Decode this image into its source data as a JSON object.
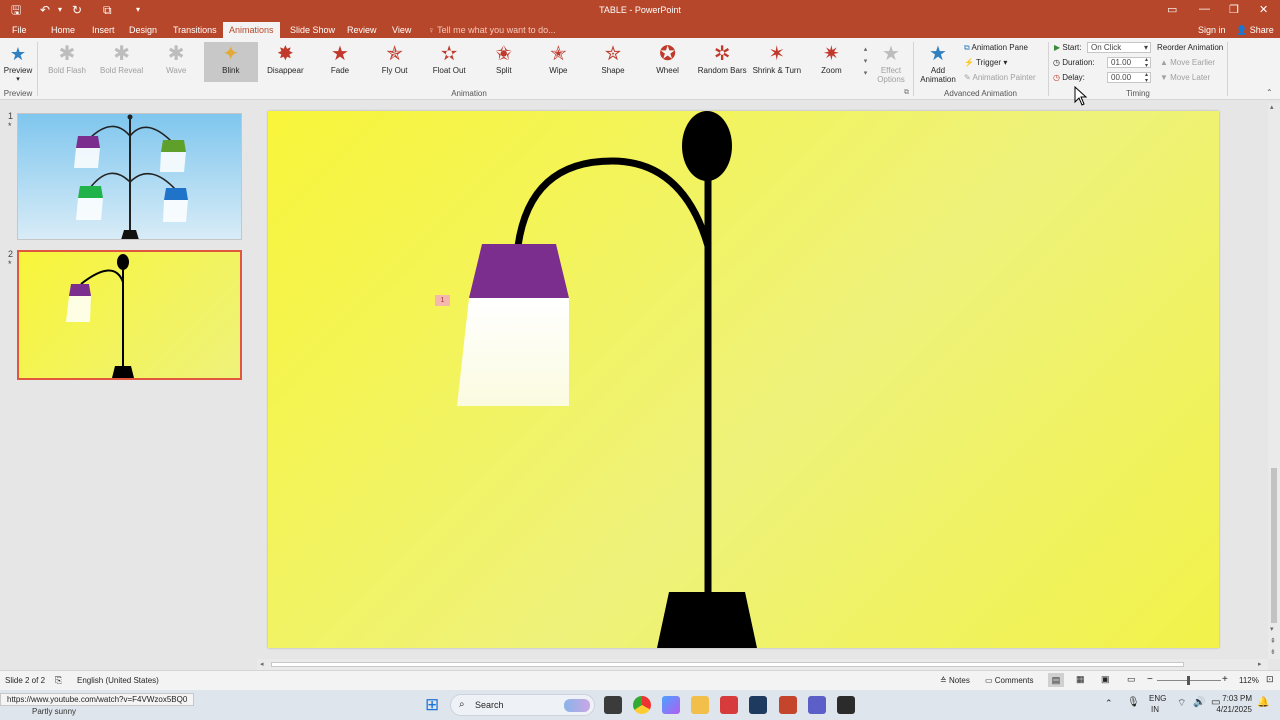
{
  "window": {
    "title": "TABLE - PowerPoint",
    "sign_in": "Sign in",
    "share": "Share"
  },
  "tabs": [
    "File",
    "Home",
    "Insert",
    "Design",
    "Transitions",
    "Animations",
    "Slide Show",
    "Review",
    "View"
  ],
  "active_tab": "Animations",
  "tell_me": "Tell me what you want to do...",
  "ribbon": {
    "preview": {
      "button": "Preview",
      "group": "Preview"
    },
    "animation_group": "Animation",
    "animations": [
      {
        "label": "Bold Flash",
        "state": "disabled"
      },
      {
        "label": "Bold Reveal",
        "state": "disabled"
      },
      {
        "label": "Wave",
        "state": "disabled"
      },
      {
        "label": "Blink",
        "state": "selected"
      },
      {
        "label": "Disappear",
        "state": "normal"
      },
      {
        "label": "Fade",
        "state": "normal"
      },
      {
        "label": "Fly Out",
        "state": "normal"
      },
      {
        "label": "Float Out",
        "state": "normal"
      },
      {
        "label": "Split",
        "state": "normal"
      },
      {
        "label": "Wipe",
        "state": "normal"
      },
      {
        "label": "Shape",
        "state": "normal"
      },
      {
        "label": "Wheel",
        "state": "normal"
      },
      {
        "label": "Random Bars",
        "state": "normal"
      },
      {
        "label": "Shrink & Turn",
        "state": "normal"
      },
      {
        "label": "Zoom",
        "state": "normal"
      }
    ],
    "effect_options": {
      "line1": "Effect",
      "line2": "Options"
    },
    "advanced": {
      "group": "Advanced Animation",
      "add_line1": "Add",
      "add_line2": "Animation",
      "pane": "Animation Pane",
      "trigger": "Trigger",
      "painter": "Animation Painter"
    },
    "timing": {
      "group": "Timing",
      "start_label": "Start:",
      "start_value": "On Click",
      "duration_label": "Duration:",
      "duration_value": "01.00",
      "delay_label": "Delay:",
      "delay_value": "00.00",
      "reorder": "Reorder Animation",
      "earlier": "Move Earlier",
      "later": "Move Later"
    }
  },
  "thumbnails": [
    {
      "number": "1",
      "star": "*"
    },
    {
      "number": "2",
      "star": "*"
    }
  ],
  "slide": {
    "animation_tag": "1"
  },
  "status": {
    "slide": "Slide 2 of 2",
    "language": "English (United States)",
    "notes": "Notes",
    "comments": "Comments",
    "zoom": "112%"
  },
  "taskbar": {
    "url_tooltip": "https://www.youtube.com/watch?v=F4VWzox5BQ0",
    "weather": "Partly sunny",
    "search": "Search",
    "lang_line1": "ENG",
    "lang_line2": "IN",
    "time": "7:03 PM",
    "date": "4/21/2025"
  },
  "colors": {
    "accent": "#b7472a",
    "selection": "#e0573e",
    "slide_bg": "#f8f53a"
  }
}
